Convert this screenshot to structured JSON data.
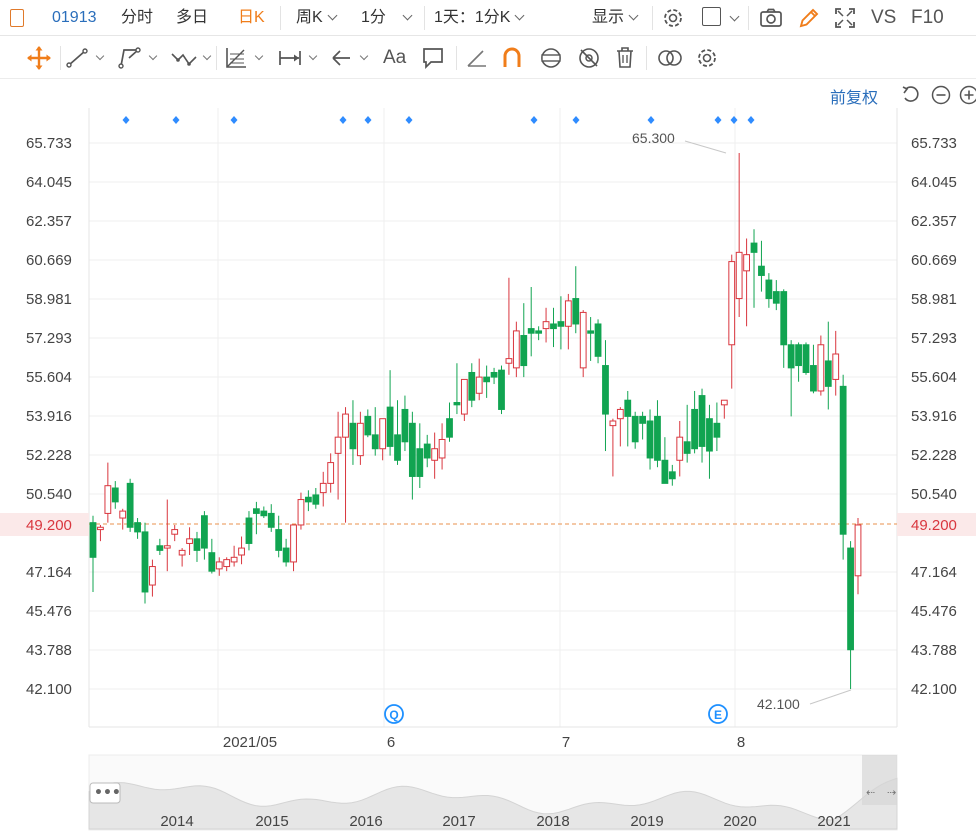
{
  "toolbar": {
    "symbol": "01913",
    "tabs": [
      {
        "label": "分时",
        "active": false
      },
      {
        "label": "多日",
        "active": false
      },
      {
        "label": "日K",
        "active": true
      },
      {
        "label": "周K",
        "active": false
      },
      {
        "label": "1分",
        "active": false
      },
      {
        "label": "1天：1分K",
        "active": false
      }
    ],
    "display_label": "显示",
    "vs_label": "VS",
    "f10_label": "F10"
  },
  "draw_tools": {
    "text_tool_label": "Aa"
  },
  "chart_controls": {
    "adjust_label": "前复权"
  },
  "colors": {
    "up": "#d9363e",
    "down": "#11a451",
    "accent": "#f07d1a",
    "link": "#2a6ebb",
    "current_price_line": "#e9924e"
  },
  "price": {
    "current": "49.200",
    "high_marker": "65.300",
    "low_marker": "42.100"
  },
  "chart_data": {
    "type": "candlestick",
    "y_ticks": [
      "65.733",
      "64.045",
      "62.357",
      "60.669",
      "58.981",
      "57.293",
      "55.604",
      "53.916",
      "52.228",
      "50.540",
      "47.164",
      "45.476",
      "43.788",
      "42.100"
    ],
    "x_ticks": [
      "2021/05",
      "6",
      "7",
      "8"
    ],
    "event_badges": [
      "Q",
      "E"
    ],
    "nav_years": [
      "2014",
      "2015",
      "2016",
      "2017",
      "2018",
      "2019",
      "2020",
      "2021"
    ],
    "candles": [
      {
        "o": 49.3,
        "h": 49.6,
        "l": 46.3,
        "c": 47.8
      },
      {
        "o": 49.0,
        "h": 49.2,
        "l": 48.5,
        "c": 49.1
      },
      {
        "o": 49.7,
        "h": 51.9,
        "l": 49.3,
        "c": 50.9
      },
      {
        "o": 50.8,
        "h": 51.1,
        "l": 49.9,
        "c": 50.2
      },
      {
        "o": 49.5,
        "h": 49.9,
        "l": 49.0,
        "c": 49.8
      },
      {
        "o": 51.0,
        "h": 51.2,
        "l": 48.9,
        "c": 49.1
      },
      {
        "o": 49.3,
        "h": 49.5,
        "l": 48.6,
        "c": 48.9
      },
      {
        "o": 48.9,
        "h": 49.3,
        "l": 45.8,
        "c": 46.3
      },
      {
        "o": 46.6,
        "h": 47.7,
        "l": 46.1,
        "c": 47.4
      },
      {
        "o": 48.3,
        "h": 48.6,
        "l": 47.9,
        "c": 48.1
      },
      {
        "o": 48.2,
        "h": 50.3,
        "l": 47.2,
        "c": 48.3
      },
      {
        "o": 48.8,
        "h": 49.2,
        "l": 48.5,
        "c": 49.0
      },
      {
        "o": 47.9,
        "h": 48.2,
        "l": 47.4,
        "c": 48.1
      },
      {
        "o": 48.4,
        "h": 49.1,
        "l": 47.9,
        "c": 48.6
      },
      {
        "o": 48.6,
        "h": 48.9,
        "l": 47.6,
        "c": 48.1
      },
      {
        "o": 49.6,
        "h": 49.8,
        "l": 47.7,
        "c": 48.2
      },
      {
        "o": 48.0,
        "h": 48.6,
        "l": 47.1,
        "c": 47.2
      },
      {
        "o": 47.3,
        "h": 47.8,
        "l": 47.0,
        "c": 47.6
      },
      {
        "o": 47.4,
        "h": 47.8,
        "l": 47.2,
        "c": 47.7
      },
      {
        "o": 47.6,
        "h": 48.3,
        "l": 47.4,
        "c": 47.8
      },
      {
        "o": 47.9,
        "h": 48.7,
        "l": 47.5,
        "c": 48.2
      },
      {
        "o": 49.5,
        "h": 49.8,
        "l": 48.1,
        "c": 48.4
      },
      {
        "o": 49.9,
        "h": 50.2,
        "l": 48.8,
        "c": 49.7
      },
      {
        "o": 49.8,
        "h": 50.0,
        "l": 49.5,
        "c": 49.6
      },
      {
        "o": 49.7,
        "h": 50.1,
        "l": 48.9,
        "c": 49.1
      },
      {
        "o": 49.0,
        "h": 49.6,
        "l": 47.8,
        "c": 48.1
      },
      {
        "o": 48.2,
        "h": 48.6,
        "l": 47.4,
        "c": 47.6
      },
      {
        "o": 47.6,
        "h": 49.1,
        "l": 47.2,
        "c": 49.2
      },
      {
        "o": 49.2,
        "h": 50.6,
        "l": 49.0,
        "c": 50.3
      },
      {
        "o": 50.4,
        "h": 50.7,
        "l": 49.8,
        "c": 50.2
      },
      {
        "o": 50.5,
        "h": 50.8,
        "l": 49.9,
        "c": 50.1
      },
      {
        "o": 50.6,
        "h": 51.5,
        "l": 50.0,
        "c": 51.0
      },
      {
        "o": 51.0,
        "h": 52.3,
        "l": 50.6,
        "c": 51.9
      },
      {
        "o": 52.3,
        "h": 54.1,
        "l": 50.3,
        "c": 53.0
      },
      {
        "o": 53.0,
        "h": 54.3,
        "l": 49.3,
        "c": 54.0
      },
      {
        "o": 53.6,
        "h": 54.6,
        "l": 51.8,
        "c": 52.5
      },
      {
        "o": 52.2,
        "h": 54.1,
        "l": 51.8,
        "c": 53.6
      },
      {
        "o": 53.9,
        "h": 54.2,
        "l": 53.0,
        "c": 53.1
      },
      {
        "o": 53.1,
        "h": 54.3,
        "l": 52.2,
        "c": 52.5
      },
      {
        "o": 52.5,
        "h": 53.8,
        "l": 52.0,
        "c": 53.8
      },
      {
        "o": 54.3,
        "h": 55.9,
        "l": 52.2,
        "c": 52.6
      },
      {
        "o": 53.1,
        "h": 54.6,
        "l": 51.8,
        "c": 52.0
      },
      {
        "o": 54.2,
        "h": 54.8,
        "l": 52.4,
        "c": 52.8
      },
      {
        "o": 53.6,
        "h": 54.1,
        "l": 50.3,
        "c": 51.3
      },
      {
        "o": 52.5,
        "h": 53.6,
        "l": 50.8,
        "c": 51.3
      },
      {
        "o": 52.7,
        "h": 53.1,
        "l": 51.7,
        "c": 52.1
      },
      {
        "o": 52.0,
        "h": 53.2,
        "l": 51.2,
        "c": 52.5
      },
      {
        "o": 52.1,
        "h": 53.6,
        "l": 51.6,
        "c": 52.9
      },
      {
        "o": 53.8,
        "h": 54.5,
        "l": 52.8,
        "c": 53.0
      },
      {
        "o": 54.5,
        "h": 56.2,
        "l": 54.0,
        "c": 54.4
      },
      {
        "o": 54.0,
        "h": 55.3,
        "l": 53.7,
        "c": 55.5
      },
      {
        "o": 55.8,
        "h": 56.2,
        "l": 54.3,
        "c": 54.6
      },
      {
        "o": 54.9,
        "h": 56.4,
        "l": 54.6,
        "c": 55.6
      },
      {
        "o": 55.6,
        "h": 56.1,
        "l": 54.7,
        "c": 55.4
      },
      {
        "o": 55.8,
        "h": 56.0,
        "l": 55.3,
        "c": 55.6
      },
      {
        "o": 55.9,
        "h": 56.1,
        "l": 54.0,
        "c": 54.2
      },
      {
        "o": 56.2,
        "h": 59.9,
        "l": 55.7,
        "c": 56.4
      },
      {
        "o": 56.0,
        "h": 58.0,
        "l": 55.6,
        "c": 57.6
      },
      {
        "o": 57.4,
        "h": 58.8,
        "l": 55.6,
        "c": 56.1
      },
      {
        "o": 57.7,
        "h": 59.5,
        "l": 56.5,
        "c": 57.5
      },
      {
        "o": 57.6,
        "h": 57.8,
        "l": 57.2,
        "c": 57.5
      },
      {
        "o": 57.7,
        "h": 58.6,
        "l": 57.1,
        "c": 58.0
      },
      {
        "o": 57.9,
        "h": 58.6,
        "l": 56.9,
        "c": 57.7
      },
      {
        "o": 58.0,
        "h": 59.1,
        "l": 56.8,
        "c": 57.8
      },
      {
        "o": 57.8,
        "h": 59.2,
        "l": 56.8,
        "c": 58.9
      },
      {
        "o": 59.0,
        "h": 60.4,
        "l": 57.5,
        "c": 57.9
      },
      {
        "o": 56.0,
        "h": 58.5,
        "l": 55.6,
        "c": 58.4
      },
      {
        "o": 57.6,
        "h": 58.2,
        "l": 56.3,
        "c": 57.5
      },
      {
        "o": 57.9,
        "h": 58.1,
        "l": 56.2,
        "c": 56.5
      },
      {
        "o": 56.1,
        "h": 57.2,
        "l": 52.4,
        "c": 54.0
      },
      {
        "o": 53.5,
        "h": 53.8,
        "l": 51.3,
        "c": 53.7
      },
      {
        "o": 53.8,
        "h": 54.3,
        "l": 52.6,
        "c": 54.2
      },
      {
        "o": 54.6,
        "h": 55.0,
        "l": 52.6,
        "c": 53.9
      },
      {
        "o": 53.9,
        "h": 54.1,
        "l": 52.5,
        "c": 52.8
      },
      {
        "o": 53.9,
        "h": 54.1,
        "l": 52.9,
        "c": 53.6
      },
      {
        "o": 53.7,
        "h": 54.2,
        "l": 51.6,
        "c": 52.1
      },
      {
        "o": 53.9,
        "h": 54.6,
        "l": 51.7,
        "c": 52.0
      },
      {
        "o": 52.0,
        "h": 53.0,
        "l": 51.1,
        "c": 51.0
      },
      {
        "o": 51.5,
        "h": 51.8,
        "l": 50.9,
        "c": 51.2
      },
      {
        "o": 52.0,
        "h": 53.7,
        "l": 51.3,
        "c": 53.0
      },
      {
        "o": 52.8,
        "h": 54.4,
        "l": 51.9,
        "c": 52.3
      },
      {
        "o": 54.2,
        "h": 55.0,
        "l": 52.3,
        "c": 52.5
      },
      {
        "o": 54.8,
        "h": 55.1,
        "l": 51.9,
        "c": 52.6
      },
      {
        "o": 53.8,
        "h": 54.4,
        "l": 51.2,
        "c": 52.4
      },
      {
        "o": 53.6,
        "h": 54.5,
        "l": 52.4,
        "c": 53.0
      },
      {
        "o": 54.4,
        "h": 54.6,
        "l": 53.8,
        "c": 54.6
      },
      {
        "o": 57.0,
        "h": 60.9,
        "l": 55.1,
        "c": 60.6
      },
      {
        "o": 59.0,
        "h": 65.3,
        "l": 58.2,
        "c": 61.0
      },
      {
        "o": 60.2,
        "h": 61.6,
        "l": 57.8,
        "c": 60.9
      },
      {
        "o": 61.4,
        "h": 62.0,
        "l": 58.6,
        "c": 61.0
      },
      {
        "o": 60.4,
        "h": 61.5,
        "l": 59.3,
        "c": 60.0
      },
      {
        "o": 59.8,
        "h": 60.1,
        "l": 58.6,
        "c": 59.0
      },
      {
        "o": 59.3,
        "h": 59.8,
        "l": 58.5,
        "c": 58.8
      },
      {
        "o": 59.3,
        "h": 59.4,
        "l": 56.0,
        "c": 57.0
      },
      {
        "o": 57.0,
        "h": 57.2,
        "l": 53.9,
        "c": 56.0
      },
      {
        "o": 57.0,
        "h": 57.1,
        "l": 55.4,
        "c": 56.1
      },
      {
        "o": 57.0,
        "h": 57.1,
        "l": 55.7,
        "c": 55.8
      },
      {
        "o": 56.1,
        "h": 57.0,
        "l": 54.9,
        "c": 55.0
      },
      {
        "o": 55.0,
        "h": 57.4,
        "l": 54.8,
        "c": 57.0
      },
      {
        "o": 56.3,
        "h": 58.0,
        "l": 54.2,
        "c": 55.2
      },
      {
        "o": 55.5,
        "h": 57.6,
        "l": 54.8,
        "c": 56.6
      },
      {
        "o": 55.2,
        "h": 55.7,
        "l": 47.7,
        "c": 48.8
      },
      {
        "o": 48.2,
        "h": 48.5,
        "l": 42.1,
        "c": 43.8
      },
      {
        "o": 47.0,
        "h": 49.5,
        "l": 46.2,
        "c": 49.2
      }
    ]
  }
}
